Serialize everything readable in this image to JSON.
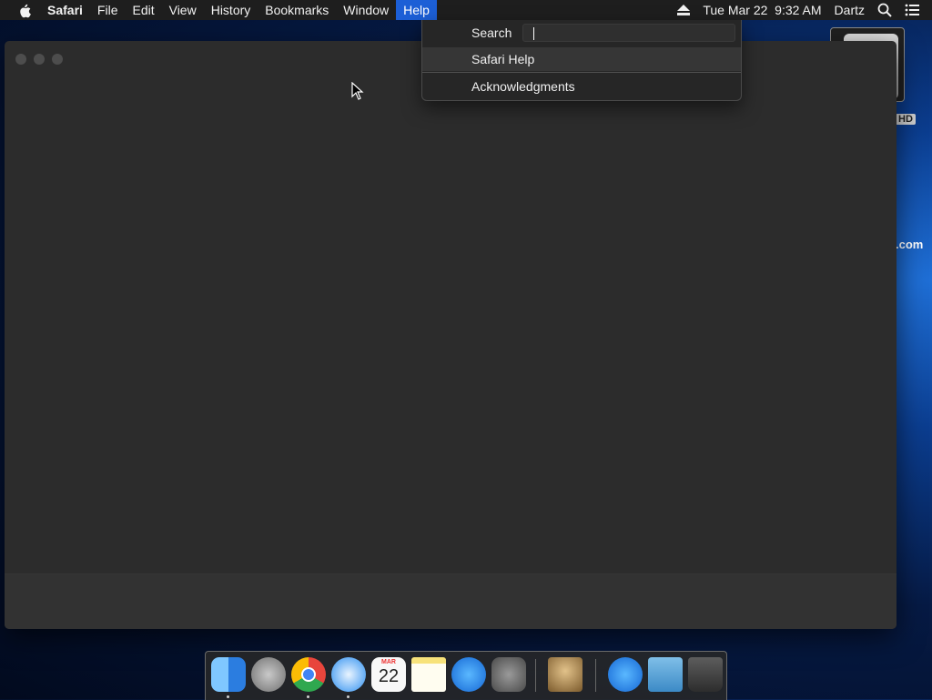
{
  "menubar": {
    "app": "Safari",
    "items": [
      "File",
      "Edit",
      "View",
      "History",
      "Bookmarks",
      "Window",
      "Help"
    ],
    "active": "Help",
    "clock": "Tue Mar 22  9:32 AM",
    "user": "Dartz",
    "icons": [
      "apple-icon",
      "eject-icon",
      "spotlight-icon",
      "notification-center-icon"
    ]
  },
  "desktop": {
    "drive_label": "HD",
    "edge_text": ".com"
  },
  "help_menu": {
    "search_label": "Search",
    "search_value": "",
    "items": [
      "Safari Help",
      "Acknowledgments"
    ]
  },
  "dock": {
    "apps": [
      "Finder",
      "Launchpad",
      "Google Chrome",
      "Safari",
      "Calendar",
      "Notes",
      "App Store",
      "System Preferences",
      "Chess",
      "Applications",
      "Downloads",
      "Trash"
    ],
    "calendar_month": "MAR",
    "calendar_day": "22"
  },
  "colors": {
    "menu_highlight": "#1c5fd6",
    "window_bg": "#2c2c2c",
    "menubar_bg": "#1e1e1e"
  }
}
